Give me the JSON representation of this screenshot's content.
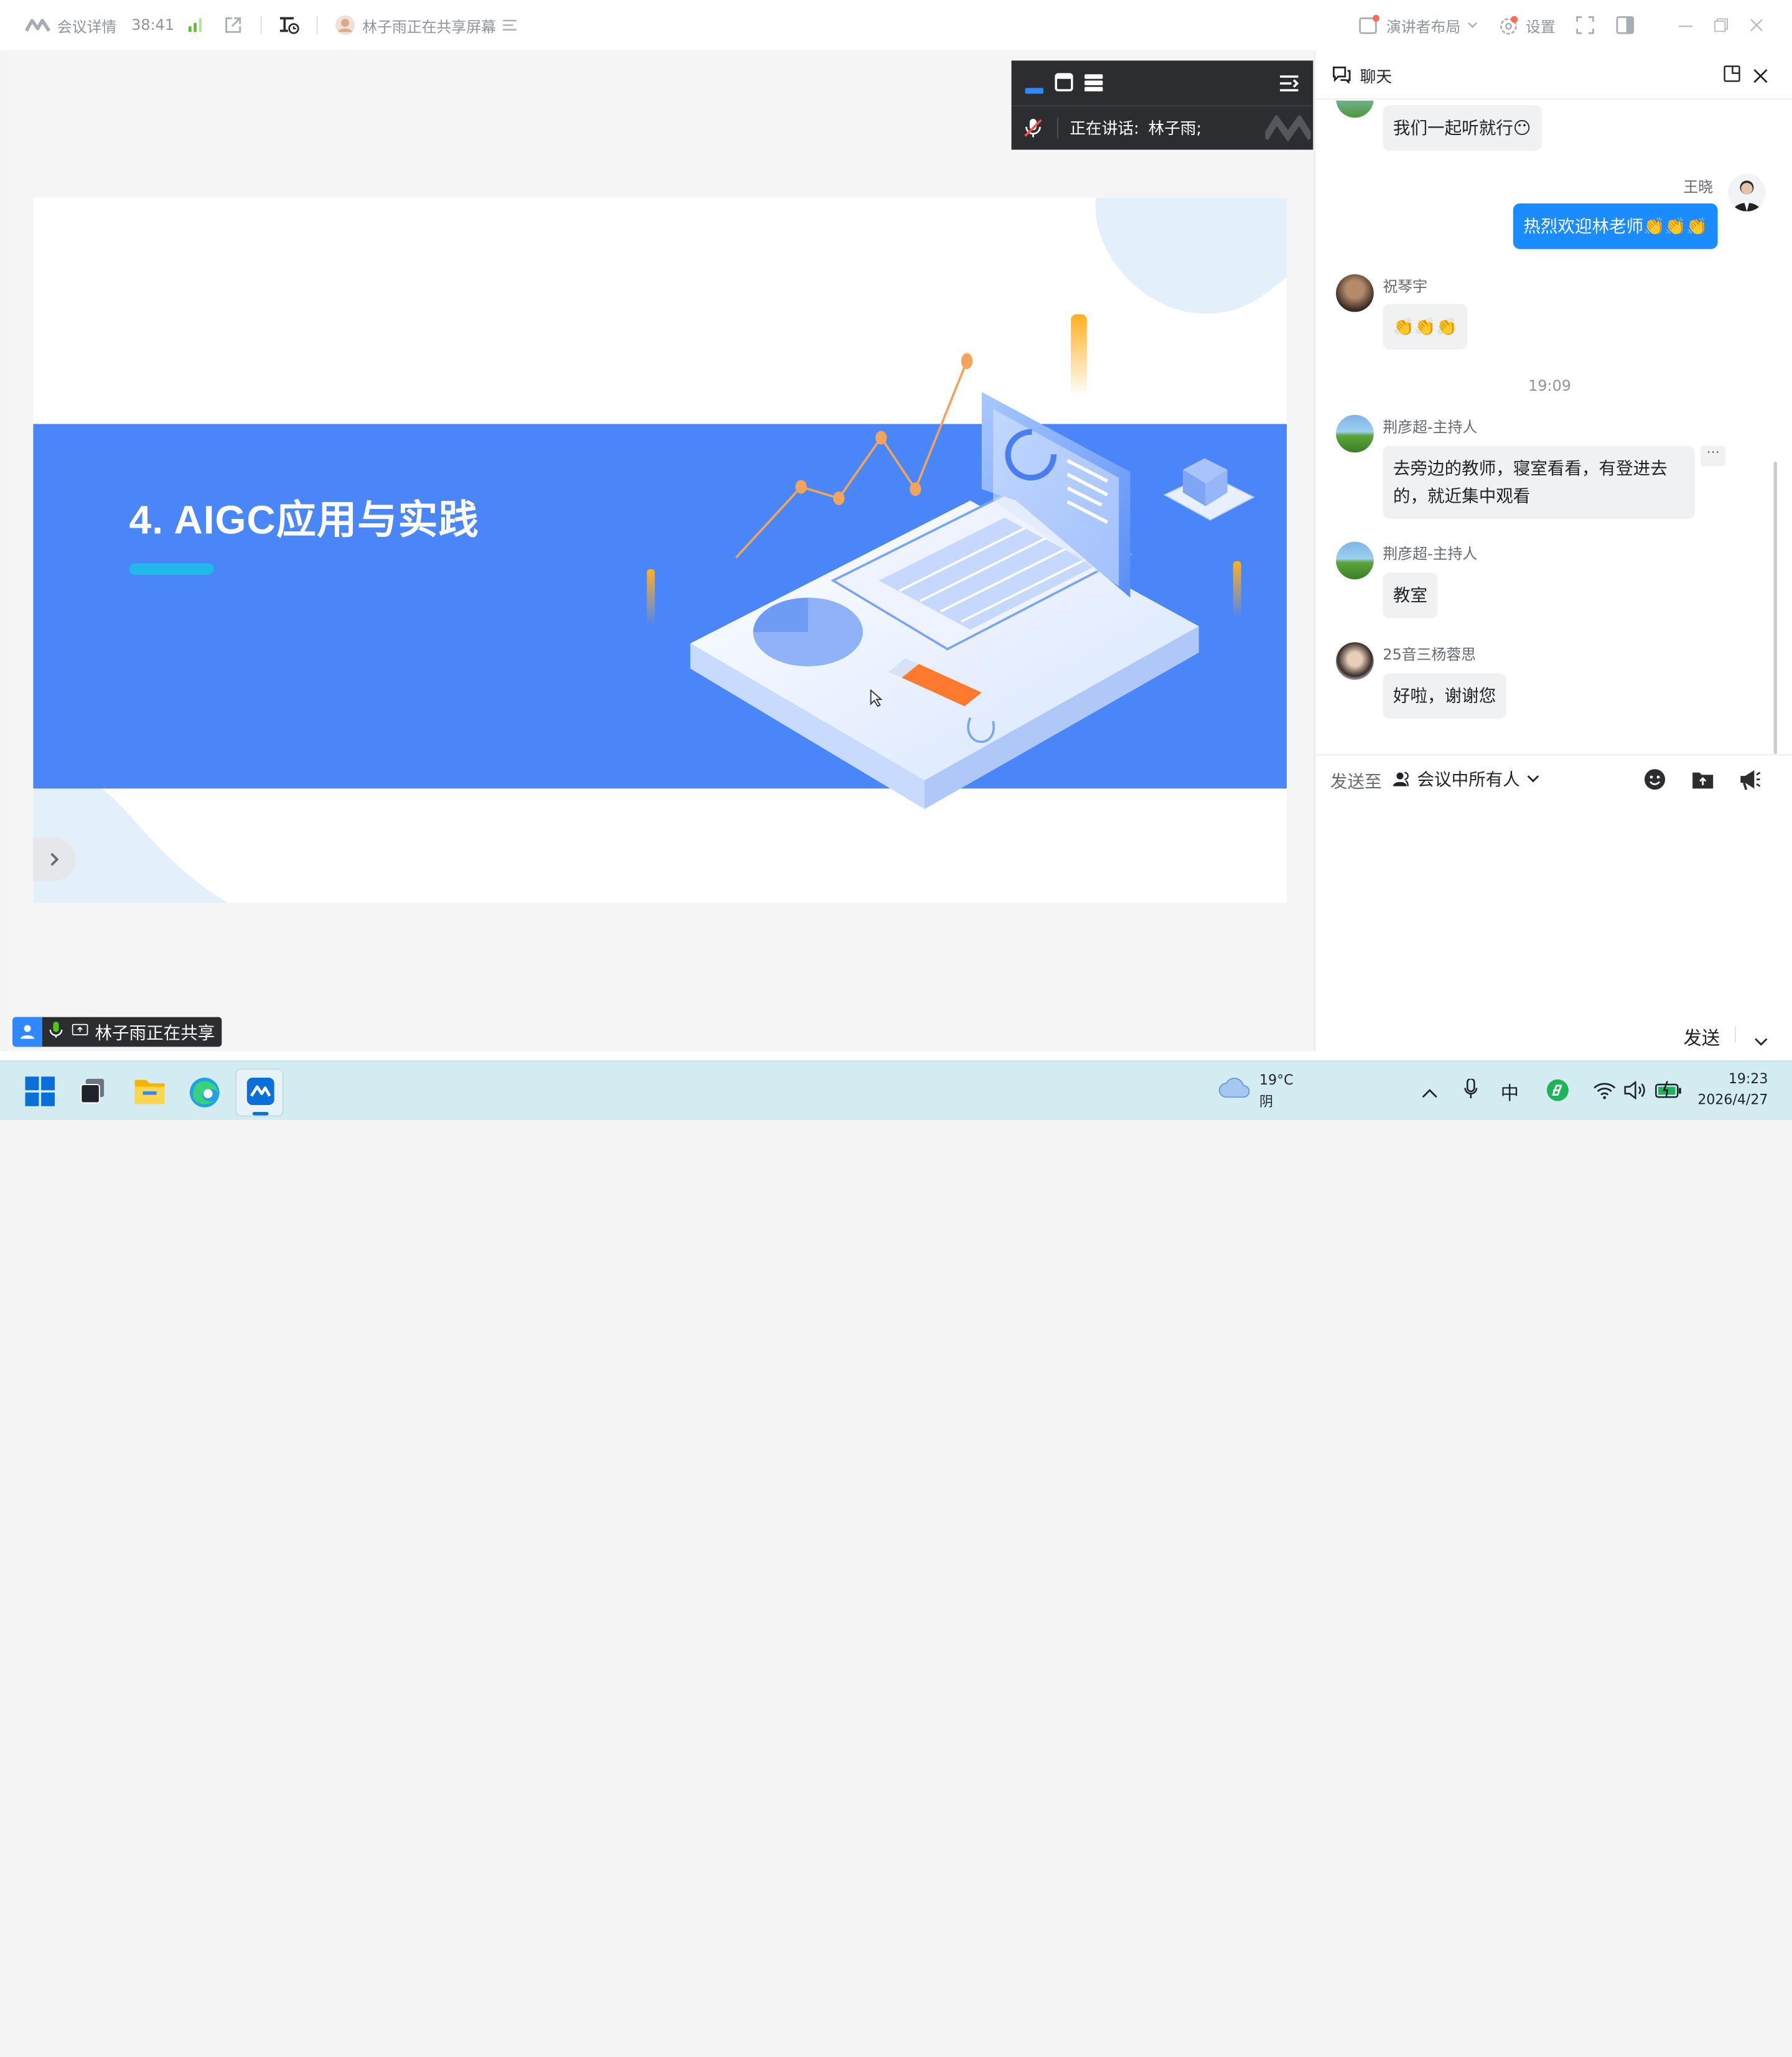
{
  "topbar": {
    "meeting_details": "会议详情",
    "duration": "38:41",
    "sharing_status": "林子雨正在共享屏幕",
    "speaker_layout": "演讲者布局",
    "settings": "设置"
  },
  "float_panel": {
    "speaking_label": "正在讲话:",
    "speaker_name": "林子雨;"
  },
  "slide": {
    "title": "4. AIGC应用与实践"
  },
  "share_tag": {
    "label": "林子雨正在共享"
  },
  "chat": {
    "title": "聊天",
    "messages": [
      {
        "sender": "",
        "text": "我们一起听就行😶"
      },
      {
        "sender": "王晓",
        "text": "热烈欢迎林老师👏👏👏"
      },
      {
        "sender": "祝琴宇",
        "text": "👏👏👏"
      },
      {
        "sender": "荆彦超-主持人",
        "text": "去旁边的教师，寝室看看，有登进去的，就近集中观看"
      },
      {
        "sender": "荆彦超-主持人",
        "text": "教室"
      },
      {
        "sender": "25音三杨蓉思",
        "text": "好啦，谢谢您"
      }
    ],
    "timestamp": "19:09",
    "send_to_label": "发送至",
    "recipient": "会议中所有人",
    "send_button": "发送"
  },
  "taskbar": {
    "temperature": "19°C",
    "weather": "阴",
    "ime": "中",
    "time": "19:23",
    "date": "2026/4/27"
  },
  "colors": {
    "accent": "#1a8cff",
    "slide_band": "#4a86f7",
    "title_bar": "#22b8ea",
    "panel_dark": "#2b2d31"
  }
}
